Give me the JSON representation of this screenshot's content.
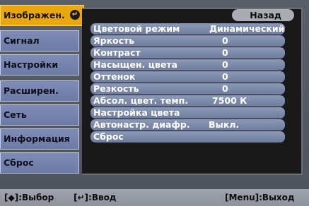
{
  "menu": [
    {
      "label": "Изображен.",
      "active": true
    },
    {
      "label": "Сигнал",
      "active": false
    },
    {
      "label": "Настройки",
      "active": false
    },
    {
      "label": "Расширен.",
      "active": false
    },
    {
      "label": "Сеть",
      "active": false
    },
    {
      "label": "Информация",
      "active": false
    },
    {
      "label": "Сброс",
      "active": false
    }
  ],
  "enter_icon_glyph": "↵",
  "back_label": "Назад",
  "settings": [
    {
      "label": "Цветовой режим",
      "value": "Динамический"
    },
    {
      "label": "Яркость",
      "value": "0"
    },
    {
      "label": "Контраст",
      "value": "0"
    },
    {
      "label": "Насыщен. цвета",
      "value": "0"
    },
    {
      "label": "Оттенок",
      "value": "0"
    },
    {
      "label": "Резкость",
      "value": "0"
    },
    {
      "label": "Абсол. цвет. темп.",
      "value": "7500  К"
    },
    {
      "label": "Настройка цвета",
      "value": ""
    },
    {
      "label": "Автонастр. диафр.",
      "value": "Выкл."
    },
    {
      "label": "Сброс",
      "value": ""
    }
  ],
  "status": {
    "select": "[◆]:Выбор",
    "enter": "[↵]:Ввод",
    "exit": "[Menu]:Выход"
  }
}
